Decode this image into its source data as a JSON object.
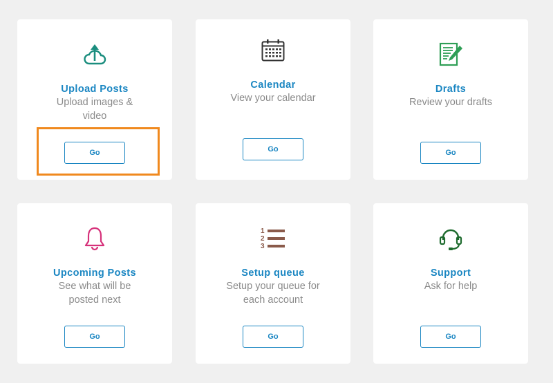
{
  "cards": [
    {
      "title": "Upload Posts",
      "desc": "Upload images & video",
      "button": "Go",
      "icon": "cloud-upload-icon",
      "icon_color": "#1a8d7e"
    },
    {
      "title": "Calendar",
      "desc": "View your calendar",
      "button": "Go",
      "icon": "calendar-icon",
      "icon_color": "#333333"
    },
    {
      "title": "Drafts",
      "desc": "Review your drafts",
      "button": "Go",
      "icon": "document-edit-icon",
      "icon_color": "#2e9e55"
    },
    {
      "title": "Upcoming Posts",
      "desc": "See what will be posted next",
      "button": "Go",
      "icon": "bell-icon",
      "icon_color": "#d6317a"
    },
    {
      "title": "Setup queue",
      "desc": "Setup your queue for each account",
      "button": "Go",
      "icon": "numbered-list-icon",
      "icon_color": "#8a5a4a"
    },
    {
      "title": "Support",
      "desc": "Ask for help",
      "button": "Go",
      "icon": "headset-icon",
      "icon_color": "#1e6b2e"
    }
  ],
  "colors": {
    "accent": "#1a86c2",
    "highlight": "#f0891e",
    "background": "#f0f0f0"
  }
}
